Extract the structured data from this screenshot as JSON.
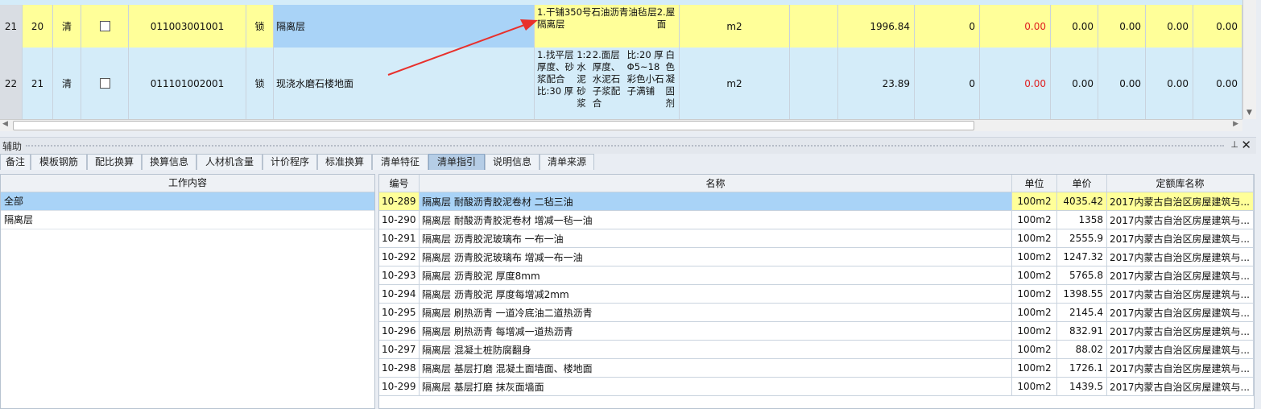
{
  "upper_grid": {
    "rows": [
      {
        "row_no": "21",
        "seq": "20",
        "type": "清",
        "code": "011003001001",
        "lock": "锁",
        "name": "隔离层",
        "desc": [
          "1.干铺350号石油沥青油毡隔离层",
          "层",
          "2.屋面"
        ],
        "unit": "m2",
        "quantity": "1996.84",
        "v1": "0",
        "v2": "0.00",
        "v3": "0.00",
        "v4": "0.00",
        "v5": "0.00",
        "v6": "0.00"
      },
      {
        "row_no": "22",
        "seq": "21",
        "type": "清",
        "code": "011101002001",
        "lock": "锁",
        "name": "现浇水磨石楼地面",
        "desc": [
          "1.找平层厚度、砂浆配合比:30 厚",
          "1:2 水泥砂浆",
          "2.面层厚度、水泥石子浆配合",
          "比:20 厚Φ5~18彩色小石子满铺",
          "白色凝固剂"
        ],
        "unit": "m2",
        "quantity": "23.89",
        "v1": "0",
        "v2": "0.00",
        "v3": "0.00",
        "v4": "0.00",
        "v5": "0.00",
        "v6": "0.00"
      }
    ]
  },
  "colors": {
    "highlight_row": "#ffff99",
    "selected_row": "#a9d3f7",
    "row_bg": "#d4ecf9",
    "arrow": "#e8302c",
    "red_value": "#e02020"
  },
  "aux_panel": {
    "title": "辅助",
    "pin_icon": "pin-icon",
    "close_icon": "close-icon",
    "tabs": [
      "备注",
      "模板钢筋",
      "配比换算",
      "换算信息",
      "人材机含量",
      "计价程序",
      "标准换算",
      "清单特征",
      "清单指引",
      "说明信息",
      "清单来源"
    ],
    "active_tab": "清单指引"
  },
  "work_content": {
    "header": "工作内容",
    "items": [
      "全部",
      "隔离层"
    ]
  },
  "quota_table": {
    "headers": {
      "code": "编号",
      "name": "名称",
      "unit": "单位",
      "price": "单价",
      "lib": "定额库名称"
    },
    "rows": [
      {
        "code": "10-289",
        "name": "隔离层 耐酸沥青胶泥卷材 二毡三油",
        "unit": "100m2",
        "price": "4035.42",
        "lib": "2017内蒙古自治区房屋建筑与..."
      },
      {
        "code": "10-290",
        "name": "隔离层 耐酸沥青胶泥卷材 增减一毡一油",
        "unit": "100m2",
        "price": "1358",
        "lib": "2017内蒙古自治区房屋建筑与..."
      },
      {
        "code": "10-291",
        "name": "隔离层 沥青胶泥玻璃布 一布一油",
        "unit": "100m2",
        "price": "2555.9",
        "lib": "2017内蒙古自治区房屋建筑与..."
      },
      {
        "code": "10-292",
        "name": "隔离层 沥青胶泥玻璃布 增减一布一油",
        "unit": "100m2",
        "price": "1247.32",
        "lib": "2017内蒙古自治区房屋建筑与..."
      },
      {
        "code": "10-293",
        "name": "隔离层 沥青胶泥 厚度8mm",
        "unit": "100m2",
        "price": "5765.8",
        "lib": "2017内蒙古自治区房屋建筑与..."
      },
      {
        "code": "10-294",
        "name": "隔离层 沥青胶泥 厚度每增减2mm",
        "unit": "100m2",
        "price": "1398.55",
        "lib": "2017内蒙古自治区房屋建筑与..."
      },
      {
        "code": "10-295",
        "name": "隔离层 刷热沥青 一道冷底油二道热沥青",
        "unit": "100m2",
        "price": "2145.4",
        "lib": "2017内蒙古自治区房屋建筑与..."
      },
      {
        "code": "10-296",
        "name": "隔离层 刷热沥青 每增减一道热沥青",
        "unit": "100m2",
        "price": "832.91",
        "lib": "2017内蒙古自治区房屋建筑与..."
      },
      {
        "code": "10-297",
        "name": "隔离层 混凝土桩防腐翻身",
        "unit": "100m2",
        "price": "88.02",
        "lib": "2017内蒙古自治区房屋建筑与..."
      },
      {
        "code": "10-298",
        "name": "隔离层 基层打磨 混凝土面墙面、楼地面",
        "unit": "100m2",
        "price": "1726.1",
        "lib": "2017内蒙古自治区房屋建筑与..."
      },
      {
        "code": "10-299",
        "name": "隔离层 基层打磨 抹灰面墙面",
        "unit": "100m2",
        "price": "1439.5",
        "lib": "2017内蒙古自治区房屋建筑与..."
      }
    ]
  }
}
